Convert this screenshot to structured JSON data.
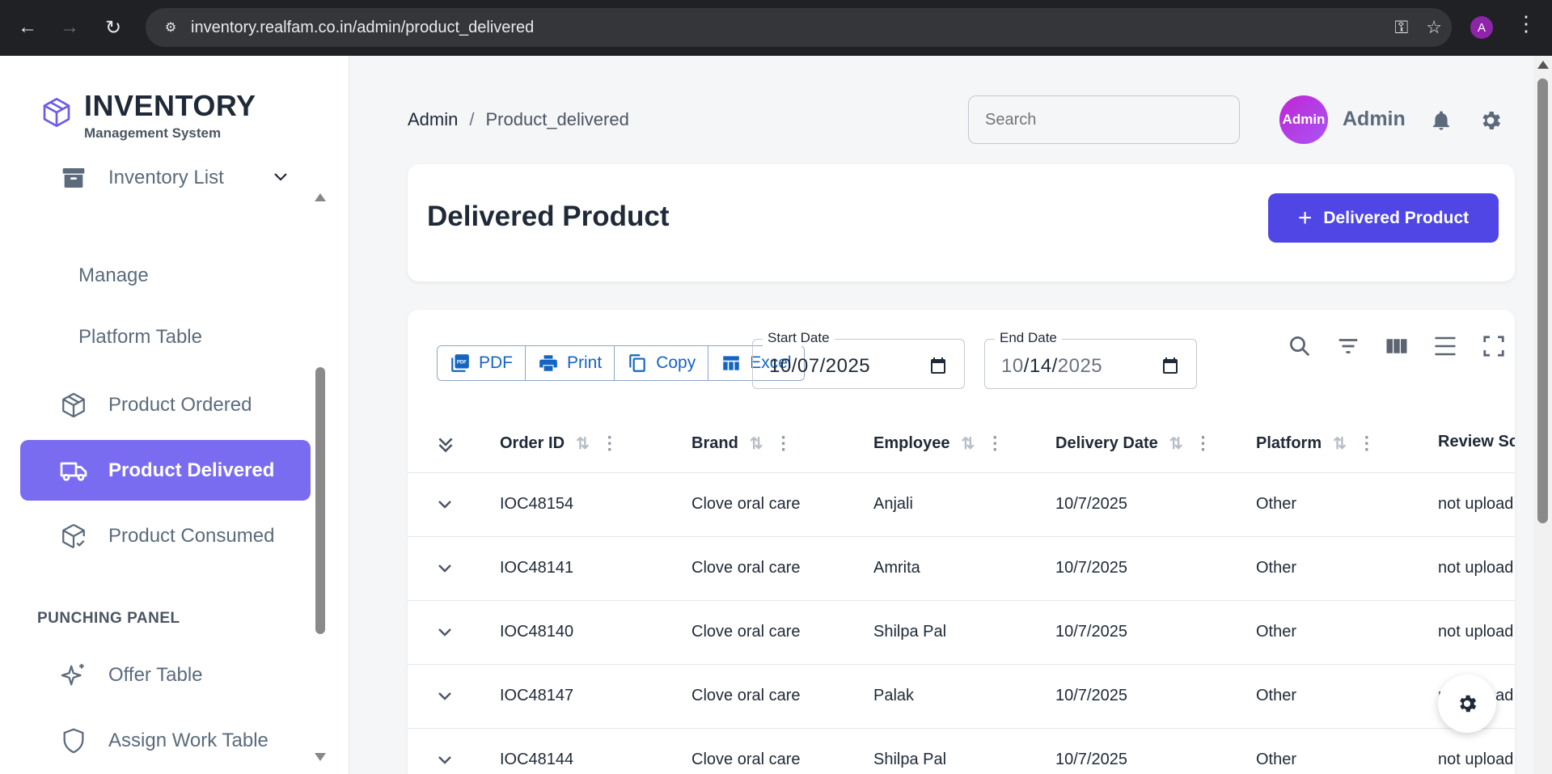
{
  "browser": {
    "url": "inventory.realfam.co.in/admin/product_delivered",
    "profile_initial": "A"
  },
  "brand": {
    "title": "INVENTORY",
    "subtitle": "Management System"
  },
  "sidebar": {
    "inventory_list": "Inventory List",
    "submenu": [
      "Manage",
      "Platform Table"
    ],
    "items": [
      {
        "label": "Product Ordered",
        "icon": "box-icon"
      },
      {
        "label": "Product Delivered",
        "icon": "truck-icon",
        "active": true
      },
      {
        "label": "Product Consumed",
        "icon": "box-check-icon"
      }
    ],
    "section_title": "PUNCHING PANEL",
    "punching_items": [
      {
        "label": "Offer Table",
        "icon": "sparkle-icon"
      },
      {
        "label": "Assign Work Table",
        "icon": "shield-icon"
      }
    ]
  },
  "header": {
    "breadcrumb_root": "Admin",
    "breadcrumb_sep": "/",
    "breadcrumb_current": "Product_delivered",
    "search_placeholder": "Search",
    "avatar_label": "Admin",
    "user_name": "Admin"
  },
  "page": {
    "title": "Delivered Product",
    "add_button": "Delivered Product"
  },
  "toolbar": {
    "export_buttons": [
      "PDF",
      "Print",
      "Copy",
      "Excel"
    ],
    "start_date_label": "Start Date",
    "start_date": {
      "m": "10",
      "d": "07",
      "y": "2025"
    },
    "end_date_label": "End Date",
    "end_date": {
      "m": "10",
      "d": "14",
      "y": "2025"
    }
  },
  "table": {
    "columns": [
      "Order ID",
      "Brand",
      "Employee",
      "Delivery Date",
      "Platform",
      "Review Sc"
    ],
    "rows": [
      [
        "IOC48154",
        "Clove oral care",
        "Anjali",
        "10/7/2025",
        "Other",
        "not upload"
      ],
      [
        "IOC48141",
        "Clove oral care",
        "Amrita",
        "10/7/2025",
        "Other",
        "not upload"
      ],
      [
        "IOC48140",
        "Clove oral care",
        "Shilpa Pal",
        "10/7/2025",
        "Other",
        "not upload"
      ],
      [
        "IOC48147",
        "Clove oral care",
        "Palak",
        "10/7/2025",
        "Other",
        "not upload"
      ],
      [
        "IOC48144",
        "Clove oral care",
        "Shilpa Pal",
        "10/7/2025",
        "Other",
        "not upload"
      ]
    ]
  },
  "colors": {
    "accent": "#4f46e5",
    "active_menu": "#7a6cf0",
    "export_blue": "#1565c0"
  }
}
